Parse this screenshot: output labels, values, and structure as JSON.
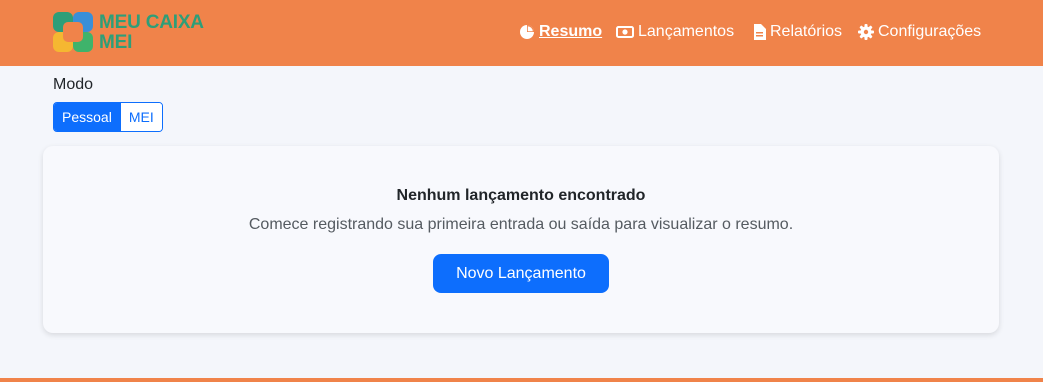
{
  "brand": {
    "line1": "MEU CAIXA",
    "line2": "MEI"
  },
  "nav": [
    {
      "label": "Resumo",
      "icon": "pie-chart-icon",
      "active": true
    },
    {
      "label": "Lançamentos",
      "icon": "cash-icon",
      "active": false
    },
    {
      "label": "Relatórios",
      "icon": "file-text-icon",
      "active": false
    },
    {
      "label": "Configurações",
      "icon": "gear-icon",
      "active": false
    }
  ],
  "mode": {
    "label": "Modo",
    "options": [
      "Pessoal",
      "MEI"
    ],
    "selected": "Pessoal"
  },
  "empty_state": {
    "title": "Nenhum lançamento encontrado",
    "subtitle": "Comece registrando sua primeira entrada ou saída para visualizar o resumo.",
    "button": "Novo Lançamento"
  },
  "colors": {
    "header": "#f0834a",
    "brand_text": "#2e9e78",
    "primary": "#0d6efd"
  }
}
